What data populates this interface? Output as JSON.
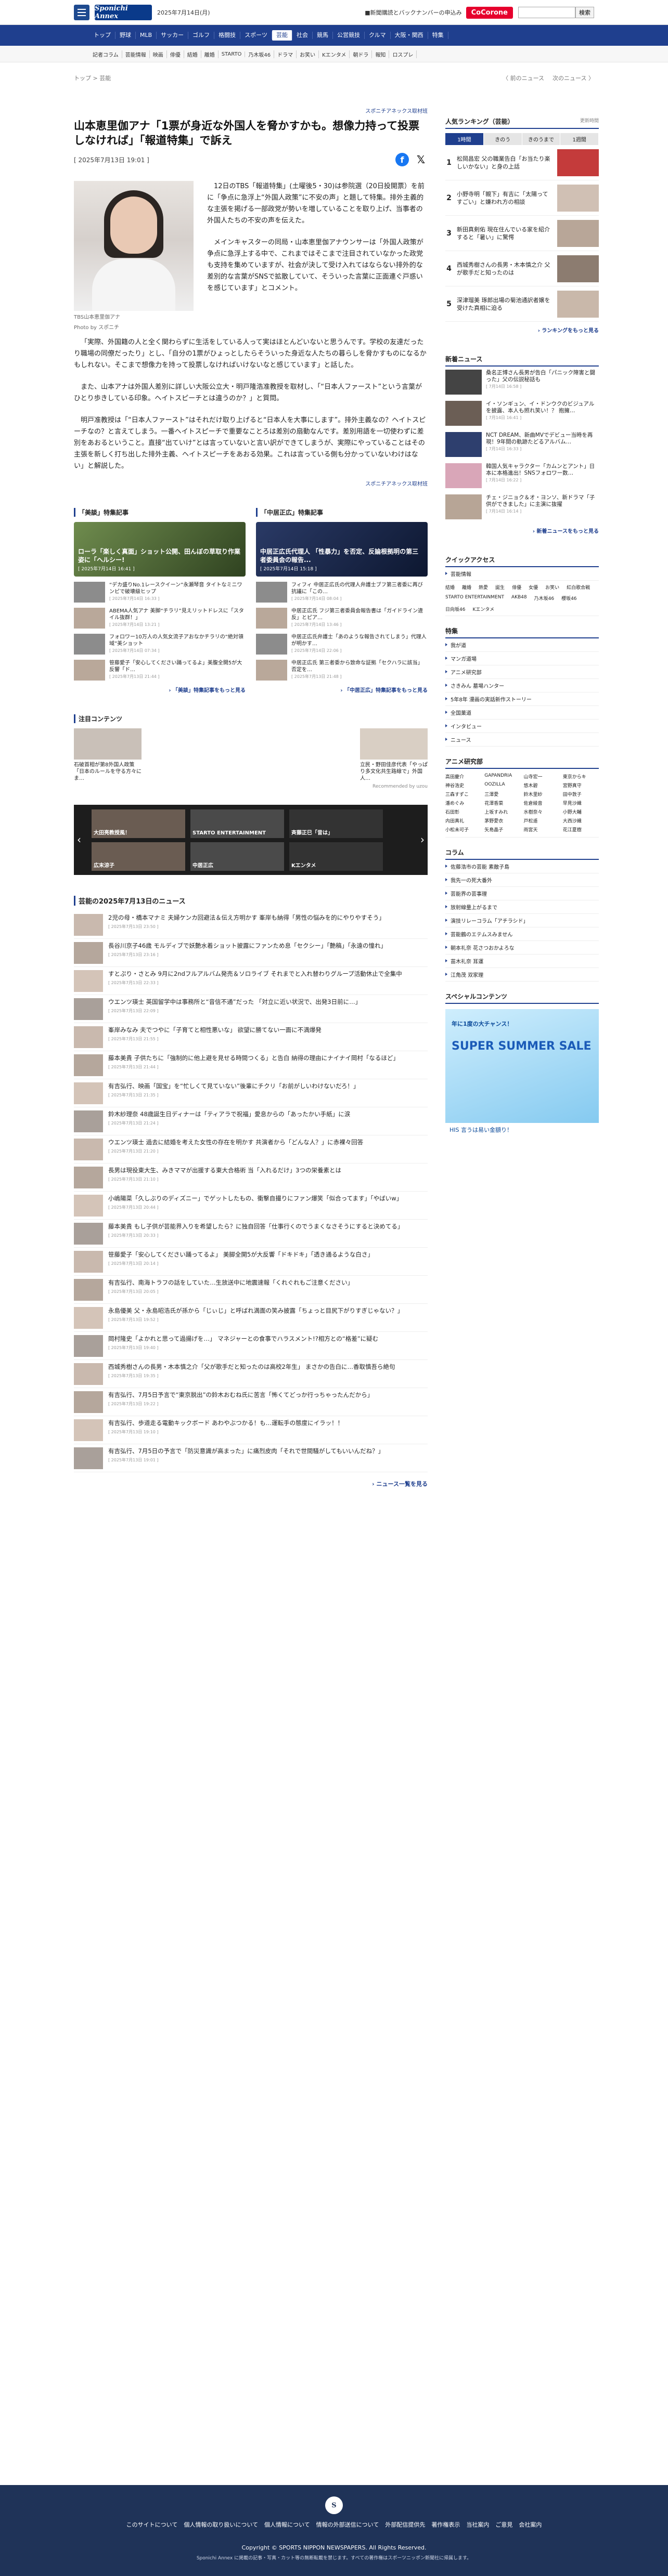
{
  "header": {
    "date": "2025年7月14日(月)",
    "notice": "■新聞購読とバックナンバーの申込み",
    "cocorone": "CoCorone",
    "search_placeholder": "",
    "search_btn": "検索",
    "logo": "Sponichi Annex"
  },
  "gnav": [
    "トップ",
    "野球",
    "MLB",
    "サッカー",
    "ゴルフ",
    "格闘技",
    "スポーツ",
    "芸能",
    "社会",
    "競馬",
    "公営競技",
    "クルマ",
    "大阪・関西",
    "特集"
  ],
  "gnav_active": 7,
  "subnav": [
    "記者コラム",
    "芸能情報",
    "映画",
    "俳優",
    "結婚",
    "離婚",
    "STARTO",
    "乃木坂46",
    "ドラマ",
    "お笑い",
    "Kエンタメ",
    "朝ドラ",
    "報知",
    "ロスプレ"
  ],
  "breadcrumb": {
    "home": "トップ",
    "sep": ">",
    "section": "芸能",
    "prev": "前のニュース",
    "next": "次のニュース"
  },
  "article": {
    "credit": "スポニチアネックス取材班",
    "title": "山本恵里伽アナ「1票が身近な外国人を脅かすかも。想像力持って投票しなければ」「報道特集」で訴え",
    "pubdate": "[ 2025年7月13日 19:01 ]",
    "photo_caption": "TBS山本恵里伽アナ",
    "photo_credit": "Photo by スポニチ",
    "p1": "12日のTBS「報道特集」(土曜後5・30)は参院選（20日投開票）を前に「争点に急浮上“外国人政策”に不安の声」と題して特集。排外主義的な主張を掲げる一部政党が勢いを増していることを取り上げ、当事者の外国人たちの不安の声を伝えた。",
    "p2": "メインキャスターの同局・山本恵里伽アナウンサーは「外国人政策が争点に急浮上する中で、これまではそこまで注目されていなかった政党も支持を集めていますが、社会が決して受け入れてはならない排外的な差別的な言葉がSNSで拡散していて、そういった言葉に正面連ぐ戸惑いを感じています」とコメント。",
    "p3": "「実際、外国籍の人と全く関わらずに生活をしている人って実はほとんどいないと思うんです。学校の友達だったり職場の同僚だったり」とし、「自分の1票がひょっとしたらそういった身近な人たちの暮らしを脅かすものになるかもしれない。そこまで想像力を持って投票しなければいけないなと感じています」と話した。",
    "p4": "また、山本アナは外国人差別に詳しい大阪公立大・明戸隆浩准教授を取材し、「“日本人ファースト”という言葉がひとり歩きしている印象。ヘイトスピーチとは違うのか？」と質問。",
    "p5": "明戸准教授は「“日本人ファースト”はそれだけ取り上げると“日本人を大事にします”。排外主義なの？ヘイトスピーチなの？と言えてしまう。一番ヘイトスピーチで重要なことろは差別の扇動なんです。差別用語を一切使わずに差別をあおるということ。直接“出ていけ”とは言っていないと言い訳ができてしまうが、実際にやっていることはその主張を新しく打ち出した排外主義、ヘイトスピーチをあおる効果。これは言っている側も分かっていないわけはない」と解説した。",
    "credit_bottom": "スポニチアネックス取材班"
  },
  "related": {
    "left": {
      "heading": "「美談」特集記事",
      "big_title": "ローラ「楽しく真面」ショット公開、田んぼの草取り作業姿に「ヘルシー!",
      "big_date": "[ 2025年7月14日 16:41 ]",
      "items": [
        {
          "title": "“デカ盛りNo.1レースクイーン”永瀬琴音 タイトなミニワンピで破壊級ヒップ",
          "date": "[ 2025年7月14日 16:33 ]"
        },
        {
          "title": "ABEMA人気アナ 美脚“チラリ”見えリットドレスに「スタイル抜群！」",
          "date": "[ 2025年7月14日 13:21 ]"
        },
        {
          "title": "フォロワー10万人の人気女流子アおなかチラリの“絶対領域”美ショット",
          "date": "[ 2025年7月14日 07:34 ]"
        },
        {
          "title": "笹藤愛子「安心してください踊ってるよ」美腹全開5が大反響「ド…",
          "date": "[ 2025年7月13日 21:44 ]"
        }
      ],
      "more": "「美談」特集記事をもっと見る"
    },
    "right": {
      "heading": "「中居正広」特集記事",
      "big_title": "中居正広氏代理人 「性暴力」を否定、反論根拠明の第三者委員会の報告...",
      "big_date": "[ 2025年7月14日 15:18 ]",
      "items": [
        {
          "title": "フィフィ 中居正広氏の代理人弁護士ブフ第三者委に再び抗議に「この…",
          "date": "[ 2025年7月14日 08:04 ]"
        },
        {
          "title": "中居正広氏 フジ第三者委員会報告書は「ガイドライン違反」とピア…",
          "date": "[ 2025年7月14日 13:46 ]"
        },
        {
          "title": "中居正広氏弁護士「あのような報告されてしまう」代理人が明かす…",
          "date": "[ 2025年7月14日 22:06 ]"
        },
        {
          "title": "中居正広氏 第三者委から致命な証拠「セクハラに該当」否定を…",
          "date": "[ 2025年7月13日 21:48 ]"
        }
      ],
      "more": "「中居正広」特集記事をもっと見る"
    }
  },
  "attention": {
    "heading": "注目コンテンツ",
    "left": "石破首相が第8外国人政策「日本のルールを守る方々にま…",
    "right": "立民・野田佳彦代表「やっぱり多文化共生路線で」外国人…",
    "source": "Recommended by uzou"
  },
  "carousel": [
    "大田亮教授風！",
    "広末涼子",
    "STARTO ENTERTAINMENT",
    "中居正広",
    "斉藤正巳「昔は」",
    "Kエンタメ"
  ],
  "news": {
    "heading": "芸能の2025年7月13日のニュース",
    "items": [
      {
        "title": "2児の母・橋本マナミ 夫婦ケンカ回避法＆伝え方明かす 峯岸も納得「男性の悩みを的にやりやすそう」",
        "date": "[ 2025年7月13日 23:50 ]"
      },
      {
        "title": "長谷川京子46歳 モルディブで妖艶水着ショット披露にファンため息「セクシー」「艶稿」「永遠の憧れ」",
        "date": "[ 2025年7月13日 23:16 ]"
      },
      {
        "title": "すとぷり・さとみ 9月に2ndフルアルバム発売＆ソロライブ それまでと入れ替わりグループ活動休止で全集中",
        "date": "[ 2025年7月13日 22:33 ]"
      },
      {
        "title": "ウエンツ瑛士 英国留学中は事務所と“音信不通”だった 「対立に近い状況で、出発3日前に…」",
        "date": "[ 2025年7月13日 22:09 ]"
      },
      {
        "title": "峯岸みなみ 夫でつやに「子育てと相性悪いな」 欲望に勝てない一面に不満爆発",
        "date": "[ 2025年7月13日 21:55 ]"
      },
      {
        "title": "藤本美貴 子供たちに「強制的に他上避を見せる時間つくる」と告白 納得の理由にナイナイ岡村「なるほど」",
        "date": "[ 2025年7月13日 21:44 ]"
      },
      {
        "title": "有吉弘行、映画「国宝」を“忙しくて見ていない”後輩にチクリ「お前がしいわけないだろ！」",
        "date": "[ 2025年7月13日 21:35 ]"
      },
      {
        "title": "鈴木紗理奈 48歳誕生日ディナーは「ティアラで祝福」愛息からの「あったかい手紙」に涙",
        "date": "[ 2025年7月13日 21:24 ]"
      },
      {
        "title": "ウエンツ瑛士 過去に結婚を考えた女性の存在を明かす 共演者から「どんな人？」に赤裸々回答",
        "date": "[ 2025年7月13日 21:20 ]"
      },
      {
        "title": "長男は現役東大生、みきママが出援する東大合格術 当「入れるだけ」3つの栄養素とは",
        "date": "[ 2025年7月13日 21:10 ]"
      },
      {
        "title": "小嶋陽菜「久しぶりのディズニー」でゲットしたもの、衝撃自撮りにファン爆笑「似合ってます」「やばいw」",
        "date": "[ 2025年7月13日 20:44 ]"
      },
      {
        "title": "藤本美貴 もし子供が芸能界入りを希望したら？に独自回答「仕事行くのでうまくなさそうにすると決めてる」",
        "date": "[ 2025年7月13日 20:33 ]"
      },
      {
        "title": "笹藤愛子「安心してください踊ってるよ」 美脚全開5が大反響「ドキドキ」「透き通るような白さ」",
        "date": "[ 2025年7月13日 20:14 ]"
      },
      {
        "title": "有吉弘行、南海トラフの話をしていた…生放送中に地震速報「くれぐれもご注意ください」",
        "date": "[ 2025年7月13日 20:05 ]"
      },
      {
        "title": "永島優美 父・永島昭浩氏が孫から「じぃじ」と呼ばれ満面の笑み披露「ちょっと目尻下がりすぎじゃない？」",
        "date": "[ 2025年7月13日 19:52 ]"
      },
      {
        "title": "岡村隆史「よかれと思って過揚げを…」 マネジャーとの食事でハラスメント!?相方との“格差”に疑む",
        "date": "[ 2025年7月13日 19:40 ]"
      },
      {
        "title": "西城秀樹さんの長男・木本慎之介「父が歌手だと知ったのは高校2年生」 まさかの告白に…香取慎吾ら絶句",
        "date": "[ 2025年7月13日 19:35 ]"
      },
      {
        "title": "有吉弘行、7月5日予言で“東京脱出”の鈴木おむね氏に苦言「怖くてどっか行っちゃったんだから」",
        "date": "[ 2025年7月13日 19:22 ]"
      },
      {
        "title": "有吉弘行、歩道走る電動キックボード あわやぶつかる！も…運転手の態度にイラッ！！",
        "date": "[ 2025年7月13日 19:10 ]"
      },
      {
        "title": "有吉弘行、7月5日の予言で「防災意識が高まった」に痛烈皮肉「それで世間騒がしてもいいんだね？」",
        "date": "[ 2025年7月13日 19:01 ]"
      }
    ],
    "more": "ニュース一覧を見る"
  },
  "sidebar": {
    "ranking": {
      "heading": "人気ランキング（芸能）",
      "updated": "更新時間",
      "tabs": [
        "1時間",
        "きのう",
        "きのうまで",
        "1週間"
      ],
      "active_tab": 0,
      "items": [
        {
          "rank": "1",
          "title": "松岡昌宏 父の職業告白「お当たり楽しいかない」と身の上話"
        },
        {
          "rank": "2",
          "title": "小野寺明「親下」有吉に「太陽ってすごい」と嫌われ方の相談"
        },
        {
          "rank": "3",
          "title": "新田真剣佑 現在住んでいる家を紹介すると「暑い」に驚愕"
        },
        {
          "rank": "4",
          "title": "西城秀樹さんの長男・木本慎之介 父が歌手だと知ったのは"
        },
        {
          "rank": "5",
          "title": "深津瑠美 琢郎出場の菊池通訳者嬢を受けた真相に迫る"
        }
      ],
      "more": "ランキングをもっと見る"
    },
    "new": {
      "heading": "新着ニュース",
      "items": [
        {
          "title": "桑名正博さん長男が告白「パニック障害と闘った」父の伝説秘話も",
          "date": "[ 7月14日 16:58 ]"
        },
        {
          "title": "イ・ソンギュン、イ・ドンウクのビジュアルを披露、本人も照れ笑い！？ 抱擁…",
          "date": "[ 7月14日 16:41 ]"
        },
        {
          "title": "NCT DREAM、新曲MVでデビュー当時を再現！9年間の軌跡たどるアルバム…",
          "date": "[ 7月14日 16:33 ]"
        },
        {
          "title": "韓国人気キャラクター「カムンとアント」日本に本格進出！SNSフォロワー数…",
          "date": "[ 7月14日 16:22 ]"
        },
        {
          "title": "チェ・ジニョク＆オ・ヨンソ、新ドラマ「子供ができました」に主演に抜擢",
          "date": "[ 7月14日 16:14 ]"
        }
      ],
      "more": "新着ニュースをもっと見る"
    },
    "quicklinks": {
      "heading": "クイックアクセス",
      "top": "芸能情報",
      "chips": [
        "結婚",
        "離婚",
        "熱愛",
        "誕生",
        "俳優",
        "女優",
        "お笑い",
        "紅白歌合戦",
        "STARTO ENTERTAINMENT",
        "AKB48",
        "乃木坂46",
        "櫻坂46",
        "日向坂46",
        "Kエンタメ"
      ]
    },
    "features": {
      "heading": "特集",
      "items": [
        "我が道",
        "マンガ道場",
        "アニメ研究部",
        "さきみん 墓場ハンター",
        "5年8年 漫画の実話新作ストーリー",
        "全国菓道",
        "インタビュー",
        "ニュース"
      ]
    },
    "anime": {
      "heading": "アニメ研究部",
      "grid": [
        "高田慶介",
        "GAPANDRIA",
        "山寺宏一",
        "東京からキ",
        "神谷浩史",
        "OOZILLA",
        "悠木碧",
        "宮野真守",
        "三森すずこ",
        "三澤愛",
        "鈴木里紗",
        "田中敦子",
        "潘めぐみ",
        "花澤香菜",
        "佐倉綾音",
        "早見沙織",
        "石田彰",
        "上坂すみれ",
        "水樹奈々",
        "小野大輔",
        "内田真礼",
        "茅野愛衣",
        "戸松遥",
        "大西沙織",
        "小松未可子",
        "矢島晶子",
        "雨宮天",
        "花江夏樹"
      ]
    },
    "column": {
      "heading": "コラム",
      "items": [
        "佐藤浩市の芸能 素敵子島",
        "我先一の死大番外",
        "芸能界の芸事理",
        "放射線量上がるまで",
        "演技リレーコラム「アチラシド」",
        "芸能鶴のエテムスみません",
        "朝本礼奈 花さつおかよろな",
        "苗木礼奈 耳運",
        "江角茂 双家理"
      ]
    },
    "special": {
      "heading": "スペシャルコンテンツ",
      "ad_title": "SUPER SUMMER SALE",
      "ad_sub": "年に1度の大チャンス！",
      "ad_bar": "HIS 言うは易い金額り！"
    }
  },
  "footer": {
    "links": [
      "このサイトについて",
      "個人情報の取り扱いについて",
      "個人情報について",
      "情報の外部送信について",
      "外部配信提供先",
      "著作権表示",
      "当社案内",
      "ご意見",
      "会社案内"
    ],
    "copyright": "Copyright © SPORTS NIPPON NEWSPAPERS. All Rights Reserved.",
    "note": "Sponichi Annex に掲載の記事・写真・カット等の無断転載を禁じます。すべての著作権はスポーツニッポン新聞社に帰属します。"
  },
  "colors": {
    "brand": "#1f3f8e",
    "footer": "#1f3358",
    "cocorone": "#e6002d"
  }
}
